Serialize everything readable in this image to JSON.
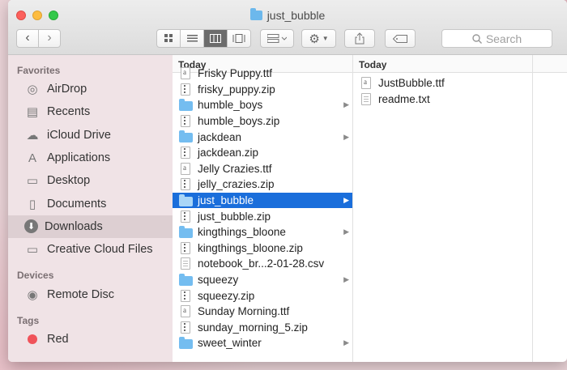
{
  "window": {
    "title": "just_bubble"
  },
  "toolbar": {
    "back_icon": "chevron-left-icon",
    "forward_icon": "chevron-right-icon",
    "views": [
      "icon-view-icon",
      "list-view-icon",
      "column-view-icon",
      "gallery-view-icon"
    ],
    "arrange_icon": "arrange-icon",
    "action_icon": "gear-icon",
    "share_icon": "share-icon",
    "tag_icon": "tag-icon",
    "search_placeholder": "Search"
  },
  "sidebar": {
    "favorites_heading": "Favorites",
    "favorites": [
      {
        "label": "AirDrop",
        "icon": "airdrop-icon"
      },
      {
        "label": "Recents",
        "icon": "recents-icon"
      },
      {
        "label": "iCloud Drive",
        "icon": "cloud-icon"
      },
      {
        "label": "Applications",
        "icon": "applications-icon"
      },
      {
        "label": "Desktop",
        "icon": "desktop-icon"
      },
      {
        "label": "Documents",
        "icon": "documents-icon"
      },
      {
        "label": "Downloads",
        "icon": "downloads-icon",
        "selected": true
      },
      {
        "label": "Creative Cloud Files",
        "icon": "folder-icon"
      }
    ],
    "devices_heading": "Devices",
    "devices": [
      {
        "label": "Remote Disc",
        "icon": "disc-icon"
      }
    ],
    "tags_heading": "Tags",
    "tags": [
      {
        "label": "Red",
        "color": "#f0535a"
      }
    ]
  },
  "column1": {
    "header": "Today",
    "items": [
      {
        "name": "Frisky Puppy.ttf",
        "kind": "font"
      },
      {
        "name": "frisky_puppy.zip",
        "kind": "zip"
      },
      {
        "name": "humble_boys",
        "kind": "folder"
      },
      {
        "name": "humble_boys.zip",
        "kind": "zip"
      },
      {
        "name": "jackdean",
        "kind": "folder"
      },
      {
        "name": "jackdean.zip",
        "kind": "zip"
      },
      {
        "name": "Jelly Crazies.ttf",
        "kind": "font"
      },
      {
        "name": "jelly_crazies.zip",
        "kind": "zip"
      },
      {
        "name": "just_bubble",
        "kind": "folder",
        "selected": true
      },
      {
        "name": "just_bubble.zip",
        "kind": "zip"
      },
      {
        "name": "kingthings_bloone",
        "kind": "folder"
      },
      {
        "name": "kingthings_bloone.zip",
        "kind": "zip"
      },
      {
        "name": "notebook_br...2-01-28.csv",
        "kind": "text"
      },
      {
        "name": "squeezy",
        "kind": "folder"
      },
      {
        "name": "squeezy.zip",
        "kind": "zip"
      },
      {
        "name": "Sunday Morning.ttf",
        "kind": "font"
      },
      {
        "name": "sunday_morning_5.zip",
        "kind": "zip"
      },
      {
        "name": "sweet_winter",
        "kind": "folder"
      }
    ]
  },
  "column2": {
    "header": "Today",
    "items": [
      {
        "name": "JustBubble.ttf",
        "kind": "font"
      },
      {
        "name": "readme.txt",
        "kind": "text"
      }
    ]
  },
  "colors": {
    "selection": "#1a6edb",
    "folder": "#74bdf0"
  }
}
